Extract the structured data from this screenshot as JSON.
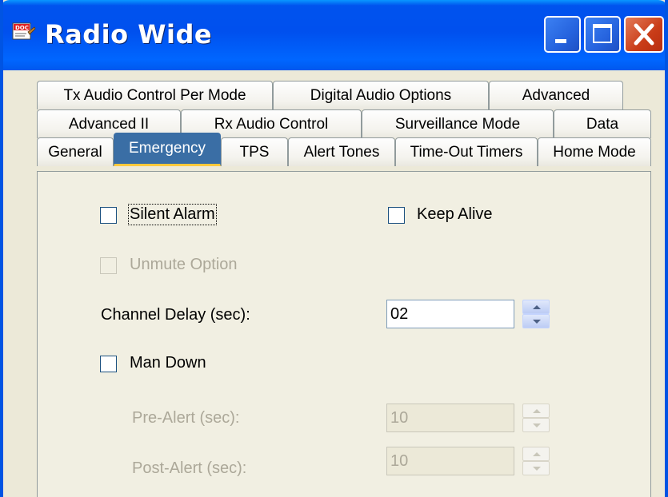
{
  "window": {
    "title": "Radio Wide",
    "icon": "doc-icon"
  },
  "tabs": {
    "row1": [
      "Tx Audio Control Per Mode",
      "Digital Audio Options",
      "Advanced"
    ],
    "row2": [
      "Advanced II",
      "Rx Audio Control",
      "Surveillance Mode",
      "Data"
    ],
    "row3": [
      "General",
      "Emergency",
      "TPS",
      "Alert Tones",
      "Time-Out Timers",
      "Home Mode"
    ],
    "active": "Emergency"
  },
  "form": {
    "silent_alarm": {
      "label": "Silent Alarm",
      "checked": false
    },
    "keep_alive": {
      "label": "Keep Alive",
      "checked": false
    },
    "unmute_option": {
      "label": "Unmute Option",
      "checked": false,
      "enabled": false
    },
    "channel_delay": {
      "label": "Channel Delay (sec):",
      "value": "02"
    },
    "man_down": {
      "label": "Man Down",
      "checked": false
    },
    "pre_alert": {
      "label": "Pre-Alert (sec):",
      "value": "10",
      "enabled": false
    },
    "post_alert": {
      "label": "Post-Alert (sec):",
      "value": "10",
      "enabled": false
    }
  },
  "colors": {
    "titlebar": "#0054e3",
    "active_tab": "#3a6ea5",
    "face": "#ece9d8"
  }
}
